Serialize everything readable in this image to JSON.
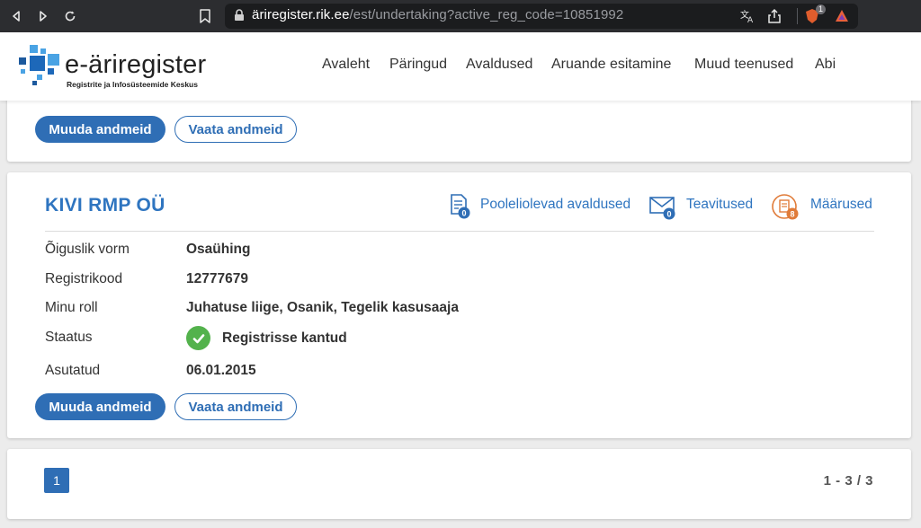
{
  "browser": {
    "url_host": "äriregister.rik.ee",
    "url_path": "/est/undertaking?active_reg_code=10851992",
    "brave_count": "1"
  },
  "header": {
    "logo_title": "e-äriregister",
    "logo_subtitle": "Registrite ja Infosüsteemide Keskus",
    "nav": [
      "Avaleht",
      "Päringud",
      "Avaldused",
      "Aruande esitamine",
      "Muud teenused",
      "Abi"
    ]
  },
  "top_card": {
    "edit_label": "Muuda andmeid",
    "view_label": "Vaata andmeid"
  },
  "company": {
    "name": "KIVI RMP OÜ",
    "links": [
      {
        "label": "Pooleliolevad avaldused",
        "count": "0",
        "icon": "document-icon"
      },
      {
        "label": "Teavitused",
        "count": "0",
        "icon": "envelope-icon"
      },
      {
        "label": "Määrused",
        "count": "8",
        "icon": "decree-icon"
      }
    ],
    "fields": [
      {
        "label": "Õiguslik vorm",
        "value": "Osaühing"
      },
      {
        "label": "Registrikood",
        "value": "12777679"
      },
      {
        "label": "Minu roll",
        "value": "Juhatuse liige, Osanik, Tegelik kasusaaja"
      },
      {
        "label": "Staatus",
        "value": "Registrisse kantud"
      },
      {
        "label": "Asutatud",
        "value": "06.01.2015"
      }
    ],
    "edit_label": "Muuda andmeid",
    "view_label": "Vaata andmeid"
  },
  "pagination": {
    "current_page": "1",
    "range": "1 - 3 / 3"
  },
  "colors": {
    "accent": "#2f6eb5",
    "link": "#2f75c0",
    "status_ok": "#53b24c",
    "badge_orange": "#e07b39"
  }
}
